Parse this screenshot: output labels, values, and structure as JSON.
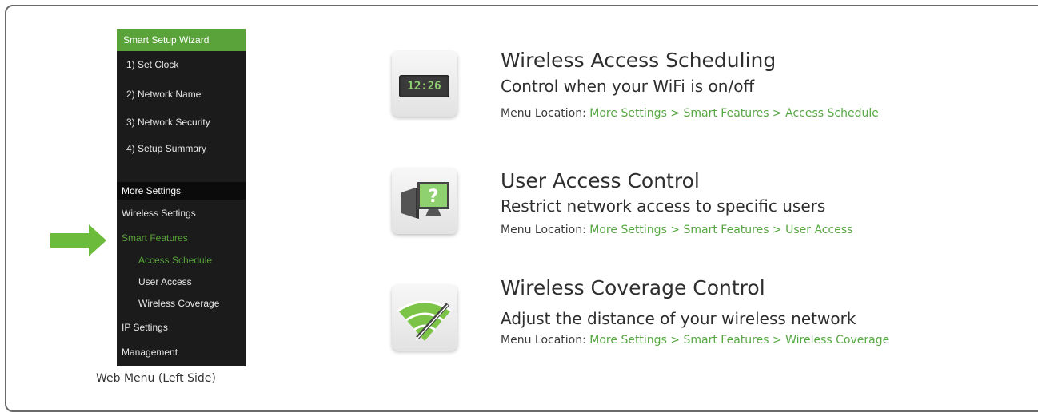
{
  "menu": {
    "wizard_header": "Smart Setup Wizard",
    "wizard_items": [
      "1) Set Clock",
      "2) Network Name",
      "3) Network Security",
      "4) Setup Summary"
    ],
    "more_header": "More Settings",
    "wireless_settings": "Wireless Settings",
    "smart_features": "Smart Features",
    "smart_sub": [
      "Access Schedule",
      "User Access",
      "Wireless Coverage"
    ],
    "ip_settings": "IP Settings",
    "management": "Management",
    "caption": "Web Menu (Left Side)"
  },
  "features": [
    {
      "icon": "clock-icon",
      "clock_text": "12:26",
      "title": "Wireless Access Scheduling",
      "subtitle": "Control when your WiFi is on/off",
      "location_label": "Menu Location: ",
      "location_path": "More Settings > Smart Features > Access Schedule"
    },
    {
      "icon": "computer-question-icon",
      "title": "User Access Control",
      "subtitle": "Restrict network access to specific users",
      "location_label": "Menu Location: ",
      "location_path": "More Settings > Smart Features > User Access"
    },
    {
      "icon": "wifi-coverage-icon",
      "title": "Wireless Coverage Control",
      "subtitle": "Adjust the distance of your wireless network",
      "location_label": "Menu Location: ",
      "location_path": "More Settings > Smart Features > Wireless Coverage"
    }
  ],
  "colors": {
    "accent": "#5aa33b",
    "menu_bg": "#1b1b1b",
    "link": "#57a843"
  }
}
